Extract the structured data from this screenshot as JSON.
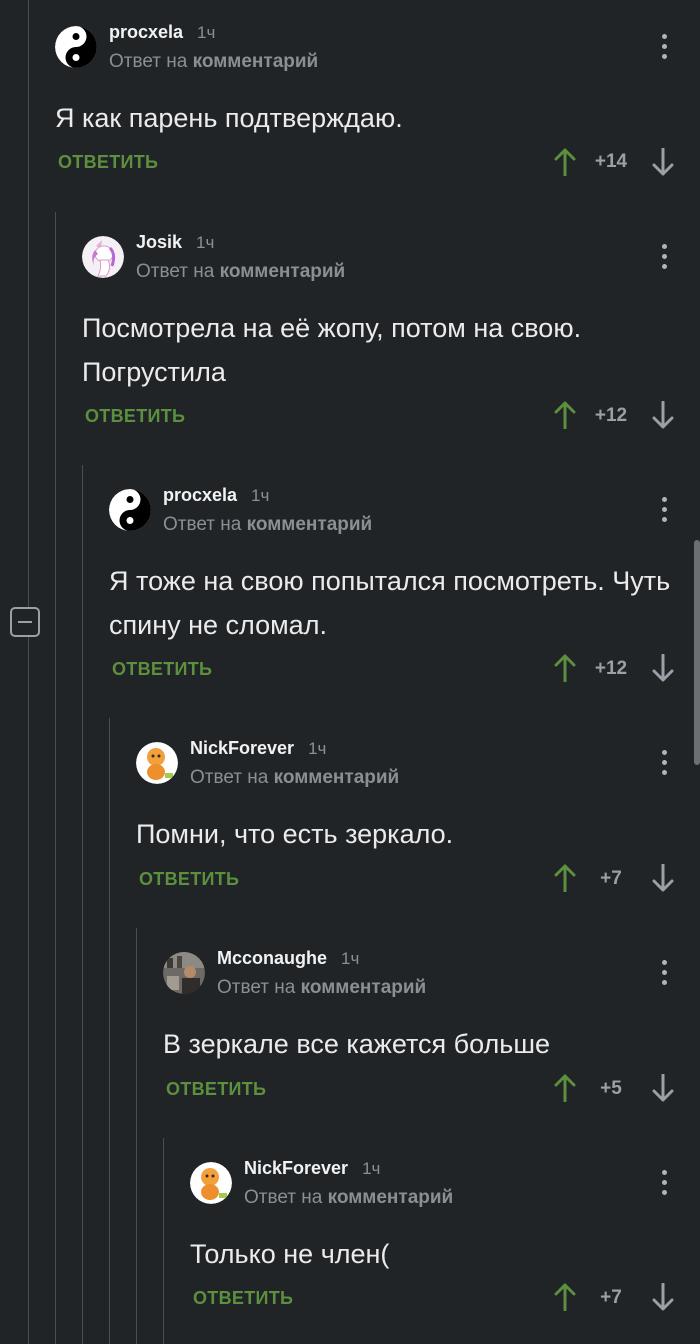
{
  "labels": {
    "reply_to_prefix": "Ответ на",
    "reply_to_link": "комментарий",
    "reply_button": "ОТВЕТИТЬ",
    "collapse_icon": "minus-square-icon",
    "menu_icon": "more-vertical-icon",
    "upvote_icon": "arrow-up-icon",
    "downvote_icon": "arrow-down-icon"
  },
  "colors": {
    "background": "#212427",
    "reply_green": "#5c8f3e",
    "upvote_green": "#5c8f3e",
    "muted_text": "#8a8f94"
  },
  "comments": [
    {
      "username": "procxela",
      "time": "1ч",
      "avatar": "yin-yang-avatar",
      "text": "Я как парень подтверждаю.",
      "score": "+14"
    },
    {
      "username": "Josik",
      "time": "1ч",
      "avatar": "unicorn-avatar",
      "text": "Посмотрела на её жопу, потом на свою. Погрустила",
      "score": "+12"
    },
    {
      "username": "procxela",
      "time": "1ч",
      "avatar": "yin-yang-avatar",
      "text": "Я тоже на свою попытался посмотреть. Чуть спину не сломал.",
      "score": "+12"
    },
    {
      "username": "NickForever",
      "time": "1ч",
      "avatar": "orange-doll-avatar",
      "text": "Помни, что есть зеркало.",
      "score": "+7"
    },
    {
      "username": "Mcconaughe",
      "time": "1ч",
      "avatar": "photo-avatar",
      "text": "В зеркале все кажется больше",
      "score": "+5"
    },
    {
      "username": "NickForever",
      "time": "1ч",
      "avatar": "orange-doll-avatar",
      "text": "Только не член(",
      "score": "+7"
    }
  ]
}
